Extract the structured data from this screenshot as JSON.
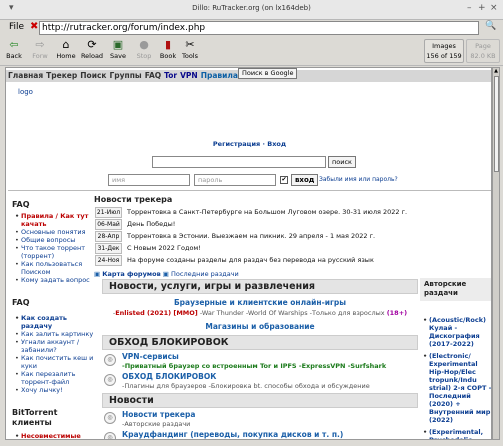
{
  "window": {
    "title": "Dillo: RuTracker.org (on lx164deb)",
    "controls": [
      "▾",
      "–",
      "+",
      "×"
    ]
  },
  "urlbar": {
    "file_label": "File",
    "stop_glyph": "✖",
    "url": "http://rutracker.org/forum/index.php",
    "search_glyph": "🔍"
  },
  "toolbar": {
    "buttons": [
      {
        "label": "Back",
        "icon": "⇦",
        "enabled": true
      },
      {
        "label": "Forw",
        "icon": "⇨",
        "enabled": false
      },
      {
        "label": "Home",
        "icon": "⌂",
        "enabled": true
      },
      {
        "label": "Reload",
        "icon": "⟳",
        "enabled": true
      },
      {
        "label": "Save",
        "icon": "▣",
        "enabled": true
      },
      {
        "label": "Stop",
        "icon": "●",
        "enabled": false
      },
      {
        "label": "Book",
        "icon": "▮",
        "enabled": true
      },
      {
        "label": "Tools",
        "icon": "✂",
        "enabled": true
      }
    ],
    "images_line1": "Images",
    "images_line2": "156 of 159",
    "page_line1": "Page",
    "page_line2": "82.0 KB"
  },
  "nav": {
    "items": [
      "Главная",
      "Трекер",
      "Поиск",
      "Группы",
      "FAQ",
      "Tor",
      "VPN",
      "Правила"
    ],
    "google_button": "Поиск в Google",
    "logo": "logo"
  },
  "auth": {
    "register": "Регистрация",
    "sep": "·",
    "login": "Вход",
    "search_button": "поиск",
    "name_placeholder": "имя",
    "password_placeholder": "пароль",
    "remember_mark": "✔",
    "enter_button": "вход",
    "forgot": "Забыли имя или пароль?"
  },
  "left": {
    "faq1_title": "FAQ",
    "faq1_items": [
      "Правила / Как тут качать",
      "Основные понятия",
      "Общие вопросы",
      "Что такое торрент (торрент)",
      "Как пользоваться Поиском",
      "Кому задать вопрос"
    ],
    "faq2_title": "FAQ",
    "faq2_items": [
      "Как создать раздачу",
      "Как залить картинку",
      "Угнали аккаунт / забанили?",
      "Как почистить кеш и куки",
      "Как перезалить торрент-файл",
      "Хочу лычку!"
    ],
    "bt_title": "BitTorrent клиенты",
    "bt_items": [
      "Несовместимые"
    ]
  },
  "news": {
    "title": "Новости трекера",
    "items": [
      {
        "date": "21-Июл",
        "text": "Торрентовка в Санкт-Петербурге на Большом Луговом озере. 30-31 июля 2022 г."
      },
      {
        "date": "06-Май",
        "text": "День Победы!"
      },
      {
        "date": "28-Апр",
        "text": "Торрентовка в Эстонии. Выезжаем на пикник. 29 апреля - 1 мая 2022 г."
      },
      {
        "date": "31-Дек",
        "text": "С Новым 2022 Годом!"
      },
      {
        "date": "24-Ноя",
        "text": "На форуме созданы разделы для раздач без перевода на русский язык"
      }
    ],
    "map_link": "Карта форумов",
    "latest_link": "Последние раздачи"
  },
  "forum": {
    "block1_title": "Новости, услуги, игры и развлечения",
    "b1_sub1": "Браузерные и клиентские онлайн-игры",
    "b1_line_parts": [
      "-",
      "Enlisted (2021) [MMO]",
      " -War Thunder -World Of Warships -Только для взрослых ",
      "(18+)"
    ],
    "b1_sub2": "Магазины и образование",
    "block2_title": "ОБХОД БЛОКИРОВОК",
    "vpn_title": "VPN-сервисы",
    "vpn_sub": "-Приватный браузер со встроенным Tor и IPFS -ExpressVPN -Surfshark",
    "bypass_title": "ОБХОД БЛОКИРОВОК",
    "bypass_sub": "-Плагины для браузеров -Блокировка bt. способы обхода и обсуждение",
    "block3_title": "Новости",
    "tn_title": "Новости трекера",
    "tn_sub": "-Авторские раздачи",
    "cf_title": "Краудфандинг (переводы, покупка дисков и т. п.)"
  },
  "right": {
    "header": "Авторские раздачи",
    "items": [
      {
        "name": "(Acoustic/Rock) Кулай - Дискография (2017-2022)"
      },
      {
        "name": "(Electronic/ Experimental Hip-Hop/Elec tropunk/Indu strial) 2-я СОРТ - Последний (2020) + Внутренний мир (2022)"
      },
      {
        "name": "(Experimental, Psychedelic, Industrial, Post Punk) Project"
      }
    ]
  }
}
